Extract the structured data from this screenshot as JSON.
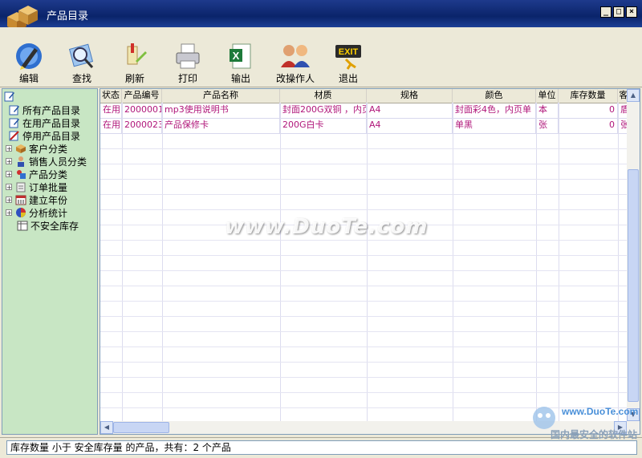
{
  "window": {
    "title": "产品目录"
  },
  "toolbar": {
    "buttons": [
      {
        "label": "编辑",
        "icon": "pen-icon"
      },
      {
        "label": "查找",
        "icon": "magnifier-icon"
      },
      {
        "label": "刷新",
        "icon": "brush-icon"
      },
      {
        "label": "打印",
        "icon": "printer-icon"
      },
      {
        "label": "输出",
        "icon": "excel-icon"
      },
      {
        "label": "改操作人",
        "icon": "users-icon"
      },
      {
        "label": "退出",
        "icon": "exit-icon"
      }
    ]
  },
  "tree": {
    "items": [
      {
        "label": "所有产品目录",
        "expandable": false
      },
      {
        "label": "在用产品目录",
        "expandable": false
      },
      {
        "label": "停用产品目录",
        "expandable": false
      },
      {
        "label": "客户分类",
        "expandable": true
      },
      {
        "label": "销售人员分类",
        "expandable": true
      },
      {
        "label": "产品分类",
        "expandable": true
      },
      {
        "label": "订单批量",
        "expandable": true
      },
      {
        "label": "建立年份",
        "expandable": true
      },
      {
        "label": "分析统计",
        "expandable": true
      },
      {
        "label": "不安全库存",
        "expandable": false
      }
    ]
  },
  "grid": {
    "columns": [
      "状态",
      "产品编号",
      "产品名称",
      "材质",
      "规格",
      "颜色",
      "单位",
      "库存数量",
      "客"
    ],
    "rows": [
      [
        "在用",
        "2000001",
        "mp3使用说明书",
        "封面200G双铜 ，内页",
        "A4",
        "封面彩4色，内页单",
        "本",
        "0",
        "盾"
      ],
      [
        "在用",
        "2000023",
        "产品保修卡",
        "200G白卡",
        "A4",
        "单黑",
        "张",
        "0",
        "张"
      ]
    ]
  },
  "watermark": "www.DuoTe.com",
  "status": {
    "text": "库存数量 小于 安全库存量 的产品，共有：2  个产品"
  },
  "brand": {
    "site": "www.DuoTe.com",
    "slogan": "国内最安全的软件站"
  },
  "colors": {
    "title_bar": "#0a246a",
    "tree_bg": "#c8e6c4",
    "row_text": "#b0167a"
  }
}
